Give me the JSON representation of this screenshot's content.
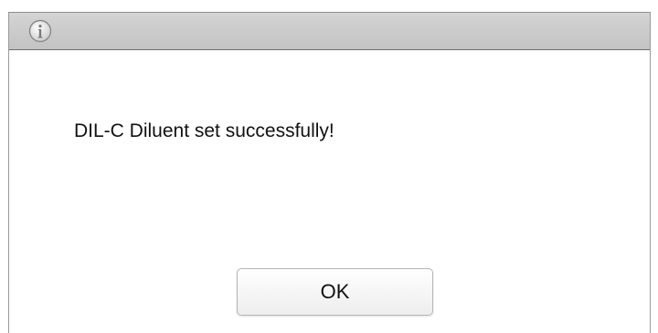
{
  "dialog": {
    "icon": "info-icon",
    "message": "DIL-C Diluent set successfully!",
    "ok_label": "OK"
  },
  "colors": {
    "titlebar": "#c8c8c8",
    "border": "#8f8f8f",
    "text": "#111111"
  }
}
